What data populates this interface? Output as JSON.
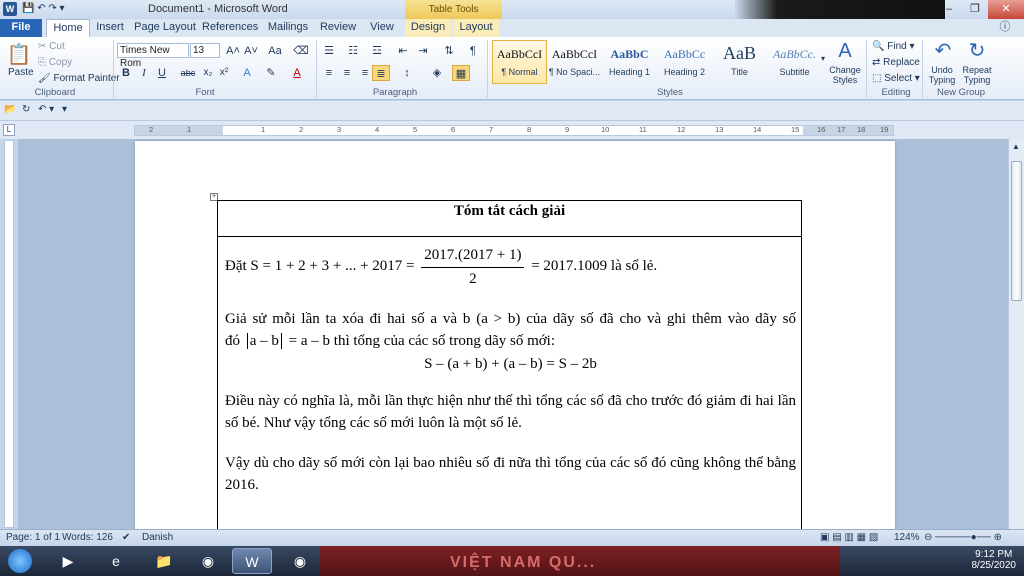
{
  "window": {
    "app_icon": "W",
    "title": "Document1 - Microsoft Word",
    "context_tab_group": "Table Tools",
    "buttons": {
      "minimize": "–",
      "restore": "❐",
      "close": "✕"
    }
  },
  "ribbon_tabs": [
    "File",
    "Home",
    "Insert",
    "Page Layout",
    "References",
    "Mailings",
    "Review",
    "View",
    "Design",
    "Layout"
  ],
  "clipboard": {
    "label": "Clipboard",
    "paste": "Paste",
    "cut": "Cut",
    "copy": "Copy",
    "format_painter": "Format Painter"
  },
  "font": {
    "label": "Font",
    "name": "Times New Rom",
    "size": "13",
    "grow": "A˄",
    "shrink": "A˅",
    "change_case": "Aa",
    "bold": "B",
    "italic": "I",
    "underline": "U",
    "strike": "abc",
    "subscript": "x₂",
    "superscript": "x²",
    "font_color": "A"
  },
  "paragraph": {
    "label": "Paragraph"
  },
  "styles": {
    "label": "Styles",
    "items": [
      {
        "sample": "AaBbCcI",
        "name": "¶ Normal"
      },
      {
        "sample": "AaBbCcI",
        "name": "¶ No Spaci..."
      },
      {
        "sample": "AaBbC",
        "name": "Heading 1"
      },
      {
        "sample": "AaBbCc",
        "name": "Heading 2"
      },
      {
        "sample": "AaB",
        "name": "Title"
      },
      {
        "sample": "AaBbCc.",
        "name": "Subtitle"
      }
    ],
    "change_styles": "Change Styles"
  },
  "editing": {
    "label": "Editing",
    "find": "Find",
    "replace": "Replace",
    "select": "Select"
  },
  "new_group": {
    "label": "New Group",
    "undo": "Undo Typing",
    "repeat": "Repeat Typing"
  },
  "ruler_numbers": [
    "2",
    "1",
    "1",
    "2",
    "3",
    "4",
    "5",
    "6",
    "7",
    "8",
    "9",
    "10",
    "11",
    "12",
    "13",
    "14",
    "15",
    "16",
    "17",
    "18",
    "19"
  ],
  "document": {
    "table_header": "Tóm tắt cách giải",
    "p1_lead": "Đặt S = 1 + 2 + 3 + ... + 2017 =",
    "p1_num": "2017.(2017 + 1)",
    "p1_den": "2",
    "p1_tail": "= 2017.1009  là số lẻ.",
    "p2_line1": "Giả sử mỗi lần ta xóa đi hai số a và b (a > b) của dãy số đã cho và ghi thêm vào dãy số",
    "p2_line2_lead": "đó",
    "p2_abs": "a – b",
    "p2_line2_tail": "= a – b  thì tổng của các số trong dãy số mới:",
    "p2_formula": "S – (a + b) + (a – b) = S – 2b",
    "p3": "Điều này có nghĩa là, mỗi lần thực hiện như thế thì tổng các số đã cho trước đó giảm đi hai lần số bé. Như vậy tổng các số mới luôn là một số lẻ.",
    "p4": "Vậy dù cho dãy số mới còn lại bao nhiêu số đi nữa thì tổng của các số đó cũng không thể bằng 2016."
  },
  "status": {
    "page": "Page: 1 of 1",
    "words": "Words: 126",
    "language": "Danish",
    "zoom": "124%"
  },
  "taskbar": {
    "background_text": "VIỆT NAM QU...",
    "time": "9:12 PM",
    "date": "8/25/2020"
  }
}
